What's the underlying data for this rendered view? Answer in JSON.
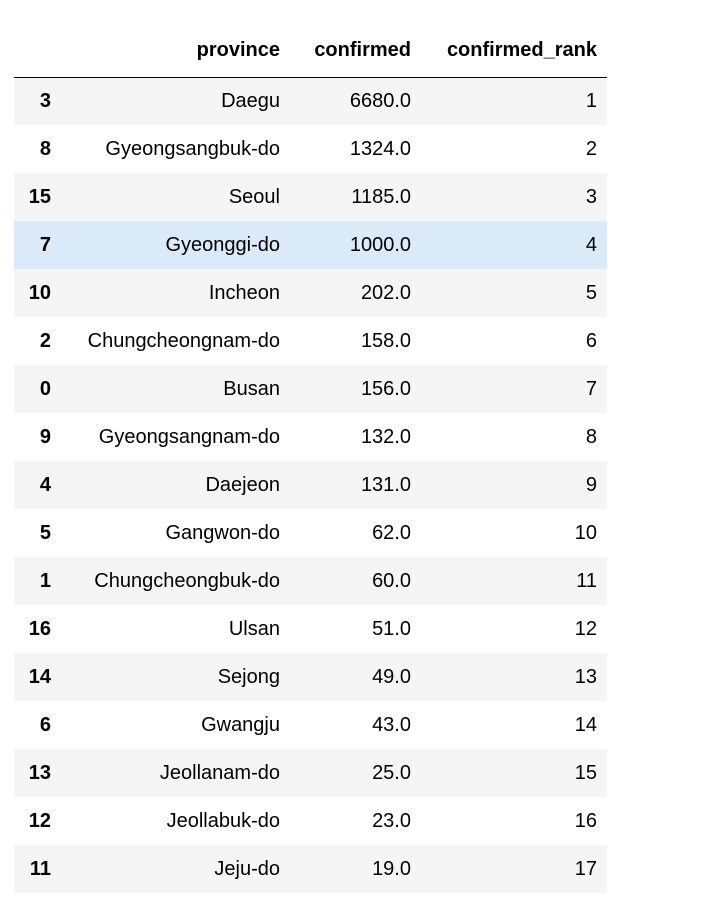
{
  "table": {
    "columns": [
      "",
      "province",
      "confirmed",
      "confirmed_rank"
    ],
    "hovered_row_index": 3,
    "hover_color": "#dbeaf9",
    "stripe_color": "#f5f5f5",
    "rows": [
      {
        "index": "3",
        "province": "Daegu",
        "confirmed": "6680.0",
        "confirmed_rank": "1"
      },
      {
        "index": "8",
        "province": "Gyeongsangbuk-do",
        "confirmed": "1324.0",
        "confirmed_rank": "2"
      },
      {
        "index": "15",
        "province": "Seoul",
        "confirmed": "1185.0",
        "confirmed_rank": "3"
      },
      {
        "index": "7",
        "province": "Gyeonggi-do",
        "confirmed": "1000.0",
        "confirmed_rank": "4"
      },
      {
        "index": "10",
        "province": "Incheon",
        "confirmed": "202.0",
        "confirmed_rank": "5"
      },
      {
        "index": "2",
        "province": "Chungcheongnam-do",
        "confirmed": "158.0",
        "confirmed_rank": "6"
      },
      {
        "index": "0",
        "province": "Busan",
        "confirmed": "156.0",
        "confirmed_rank": "7"
      },
      {
        "index": "9",
        "province": "Gyeongsangnam-do",
        "confirmed": "132.0",
        "confirmed_rank": "8"
      },
      {
        "index": "4",
        "province": "Daejeon",
        "confirmed": "131.0",
        "confirmed_rank": "9"
      },
      {
        "index": "5",
        "province": "Gangwon-do",
        "confirmed": "62.0",
        "confirmed_rank": "10"
      },
      {
        "index": "1",
        "province": "Chungcheongbuk-do",
        "confirmed": "60.0",
        "confirmed_rank": "11"
      },
      {
        "index": "16",
        "province": "Ulsan",
        "confirmed": "51.0",
        "confirmed_rank": "12"
      },
      {
        "index": "14",
        "province": "Sejong",
        "confirmed": "49.0",
        "confirmed_rank": "13"
      },
      {
        "index": "6",
        "province": "Gwangju",
        "confirmed": "43.0",
        "confirmed_rank": "14"
      },
      {
        "index": "13",
        "province": "Jeollanam-do",
        "confirmed": "25.0",
        "confirmed_rank": "15"
      },
      {
        "index": "12",
        "province": "Jeollabuk-do",
        "confirmed": "23.0",
        "confirmed_rank": "16"
      },
      {
        "index": "11",
        "province": "Jeju-do",
        "confirmed": "19.0",
        "confirmed_rank": "17"
      }
    ]
  }
}
